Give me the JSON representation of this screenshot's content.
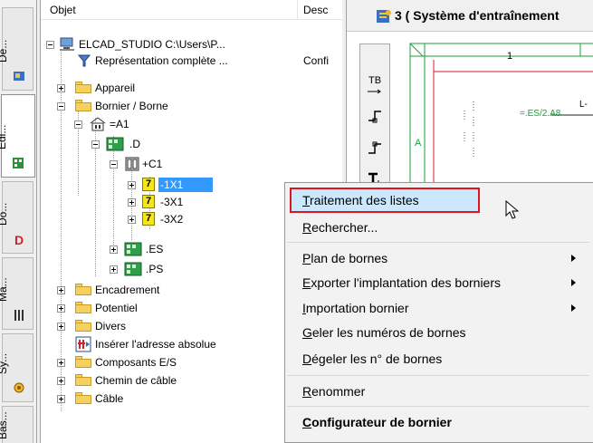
{
  "vertical_tabs": [
    {
      "label": "De...",
      "icon": "designer-icon"
    },
    {
      "label": "Edi...",
      "icon": "editor-icon"
    },
    {
      "label": "Do...",
      "icon": "document-icon"
    },
    {
      "label": "Ma...",
      "icon": "macro-icon"
    },
    {
      "label": "Sy...",
      "icon": "symbol-icon"
    },
    {
      "label": "Bas...",
      "icon": "base-icon"
    }
  ],
  "tree": {
    "columns": [
      "Objet",
      "Desc"
    ],
    "root": {
      "label": "ELCAD_STUDIO C:\\Users\\P..."
    },
    "rows": [
      {
        "label": "Représentation complète ...",
        "desc": "Confi"
      },
      {
        "label": "Appareil"
      },
      {
        "label": "Bornier / Borne"
      },
      {
        "label": "=A1"
      },
      {
        "label": ".D"
      },
      {
        "label": "+C1"
      },
      {
        "label": "-1X1",
        "badge": "7"
      },
      {
        "label": "-3X1",
        "badge": "7"
      },
      {
        "label": "-3X2",
        "badge": "7"
      },
      {
        "label": ".ES"
      },
      {
        "label": ".PS"
      },
      {
        "label": "Encadrement"
      },
      {
        "label": "Potentiel"
      },
      {
        "label": "Divers"
      },
      {
        "label": "Insérer l'adresse absolue"
      },
      {
        "label": "Composants E/S"
      },
      {
        "label": "Chemin de câble"
      },
      {
        "label": "Câble"
      }
    ]
  },
  "schematic": {
    "title": "3 ( Système d'entraînement",
    "col_numbers": [
      "1"
    ],
    "row_letter": "A",
    "net_label": "=.ES/2.A8",
    "wire_tag": "L-",
    "tools": [
      "TB"
    ]
  },
  "context_menu": {
    "items": [
      {
        "label": "Traitement des listes",
        "underline": "T",
        "rest": "raitement des listes",
        "highlighted": true
      },
      {
        "label": "Rechercher...",
        "underline": "R",
        "rest": "echercher..."
      },
      {
        "label": "Plan de bornes",
        "underline": "P",
        "rest": "lan de bornes",
        "submenu": true
      },
      {
        "label": "Exporter l'implantation des borniers",
        "underline": "E",
        "rest": "xporter l'implantation des borniers",
        "submenu": true
      },
      {
        "label": "Importation bornier",
        "underline": "I",
        "rest": "mportation bornier",
        "submenu": true
      },
      {
        "label": "Geler les numéros de bornes",
        "underline": "G",
        "rest": "eler les numéros de bornes"
      },
      {
        "label": "Dégeler les n° de bornes",
        "underline": "D",
        "rest": "égeler les n° de bornes"
      },
      {
        "label": "Renommer",
        "underline": "R",
        "rest": "enommer"
      },
      {
        "label": "Configurateur de bornier",
        "underline": "C",
        "rest": "onfigurateur de bornier",
        "bold": true
      }
    ]
  },
  "colors": {
    "accent_red": "#e0141e",
    "selection": "#3399ff",
    "folder": "#f5d160",
    "schematic_green": "#1a9e3c",
    "schematic_red": "#d81e2c"
  }
}
